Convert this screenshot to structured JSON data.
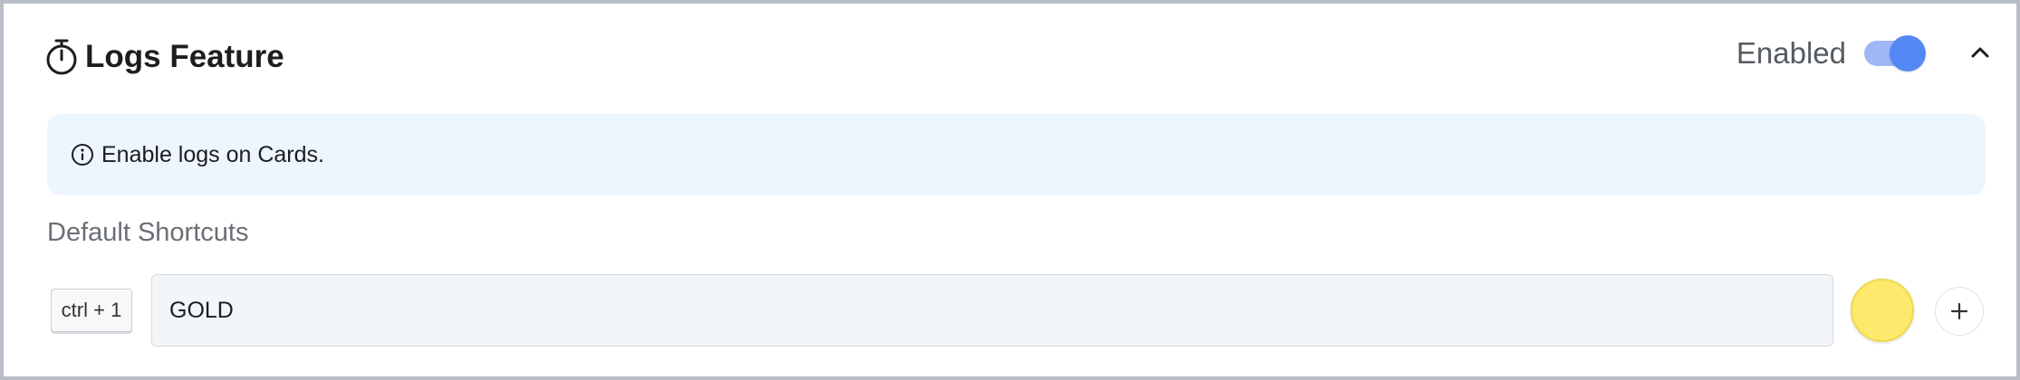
{
  "feature": {
    "icon": "stopwatch-icon",
    "title": "Logs Feature",
    "status_label": "Enabled",
    "toggle_on": true,
    "collapse_icon": "chevron-up-icon"
  },
  "info_banner": {
    "icon": "info-icon",
    "text": "Enable logs on Cards."
  },
  "shortcuts": {
    "section_label": "Default Shortcuts",
    "items": [
      {
        "key": "ctrl + 1",
        "name": "GOLD",
        "color": "#fde96c"
      }
    ],
    "add_icon": "plus-icon"
  },
  "colors": {
    "accent": "#5388f5",
    "info_bg": "#edf5fe"
  }
}
